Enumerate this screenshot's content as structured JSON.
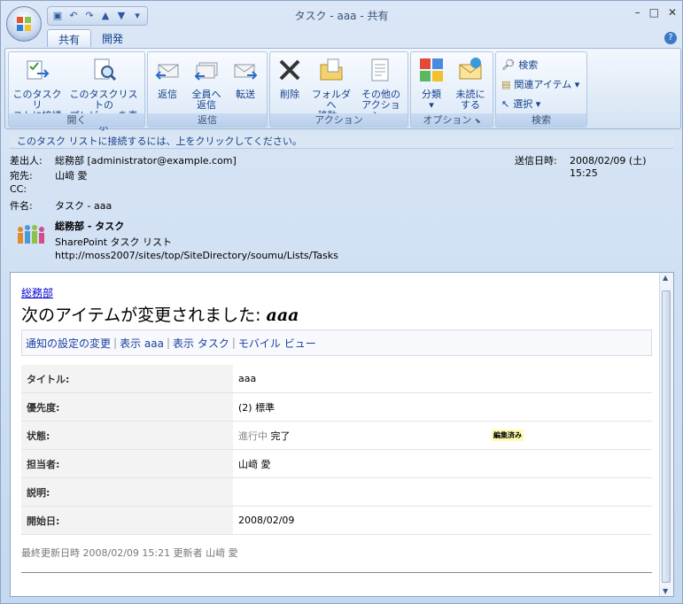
{
  "window": {
    "title": "タスク - aaa - 共有"
  },
  "tabs": [
    "共有",
    "開発"
  ],
  "ribbon": {
    "open": {
      "label": "開く",
      "connect": [
        "このタスクリ",
        "ストに接続"
      ],
      "preview": [
        "このタスクリストの",
        "プレビューを表示"
      ]
    },
    "reply": {
      "label": "返信",
      "reply": "返信",
      "reply_all": [
        "全員へ",
        "返信"
      ],
      "forward": "転送"
    },
    "actions": {
      "label": "アクション",
      "delete": "削除",
      "move": [
        "フォルダへ",
        "移動 ▾"
      ],
      "other": [
        "その他の",
        "アクション ▾"
      ]
    },
    "options": {
      "label": "オプション",
      "categorize": [
        "分類",
        "▾"
      ],
      "unread": [
        "未読に",
        "する"
      ]
    },
    "find": {
      "label": "検索",
      "search": "検索",
      "related": "関連アイテム ▾",
      "select": "選択 ▾"
    }
  },
  "infobar": "このタスク リストに接続するには、上をクリックしてください。",
  "header": {
    "from_label": "差出人:",
    "from": "総務部 [administrator@example.com]",
    "to_label": "宛先:",
    "to": "山﨑 愛",
    "cc_label": "CC:",
    "cc": "",
    "subject_label": "件名:",
    "subject": "タスク - aaa",
    "sent_label": "送信日時:",
    "sent": "2008/02/09 (土) 15:25"
  },
  "sp": {
    "title": "総務部 - タスク",
    "type": "SharePoint タスク リスト",
    "url": "http://moss2007/sites/top/SiteDirectory/soumu/Lists/Tasks"
  },
  "mail": {
    "site_link": "総務部",
    "heading": "次のアイテムが変更されました: ",
    "heading_item": "aaa",
    "links": [
      "通知の設定の変更",
      "表示 aaa",
      "表示 タスク",
      "モバイル ビュー"
    ],
    "fields": [
      {
        "name": "タイトル:",
        "value": "aaa"
      },
      {
        "name": "優先度:",
        "value": "(2) 標準"
      },
      {
        "name": "状態:",
        "old": "進行中",
        "value": "完了",
        "badge": "編集済み"
      },
      {
        "name": "担当者:",
        "value": "山﨑 愛"
      },
      {
        "name": "説明:",
        "value": ""
      },
      {
        "name": "開始日:",
        "value": "2008/02/09"
      }
    ],
    "footer": "最終更新日時 2008/02/09 15:21 更新者 山﨑 愛"
  }
}
